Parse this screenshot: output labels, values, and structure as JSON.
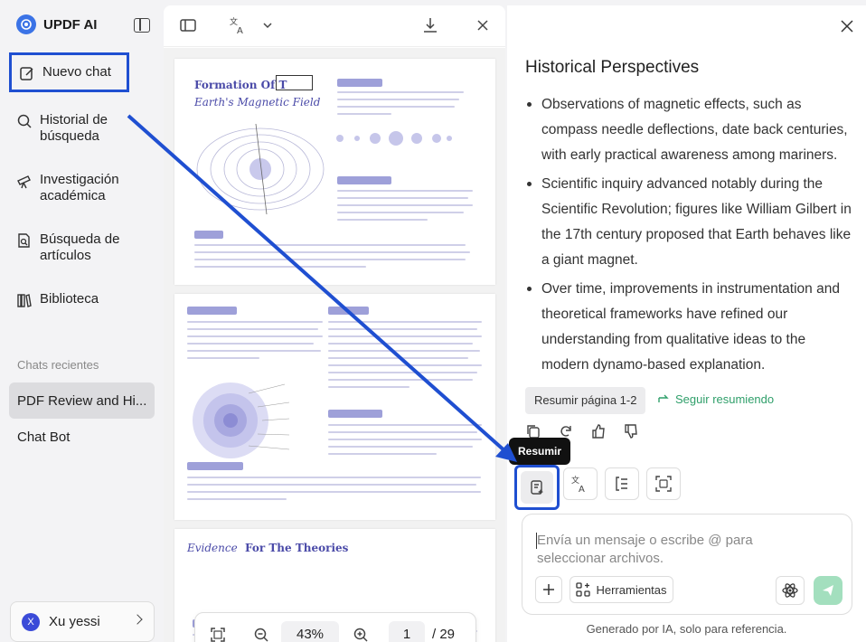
{
  "app": {
    "name": "UPDF AI",
    "accent": "#1f4fd1"
  },
  "sidebar": {
    "new_chat": "Nuevo chat",
    "items": [
      {
        "label": "Historial de búsqueda",
        "icon": "search-icon"
      },
      {
        "label": "Investigación académica",
        "icon": "telescope-icon"
      },
      {
        "label": "Búsqueda de artículos",
        "icon": "document-search-icon"
      },
      {
        "label": "Biblioteca",
        "icon": "library-icon"
      }
    ],
    "recent_label": "Chats recientes",
    "recent": [
      "PDF Review and Hi...",
      "Chat Bot"
    ],
    "user": {
      "initial": "X",
      "name": "Xu yessi"
    }
  },
  "document": {
    "page1_title_a": "Formation Of T",
    "page1_title_b": "Earth's Magnetic Field",
    "page3_title_a": "Evidence",
    "page3_title_b": "For The Theories",
    "zoom": "43%",
    "page": "1",
    "total": "/ 29"
  },
  "chat": {
    "heading": "Historical Perspectives",
    "bullets": [
      "Observations of magnetic effects, such as compass needle deflections, date back centuries, with early practical awareness among mariners.",
      "Scientific inquiry advanced notably during the Scientific Revolution; figures like William Gilbert in the 17th century proposed that Earth behaves like a giant magnet.",
      "Over time, improvements in instrumentation and theoretical frameworks have refined our understanding from qualitative ideas to the modern dynamo-based explanation."
    ],
    "summary_chip": "Resumir página 1-2",
    "continue_link": "Seguir resumiendo",
    "tooltip": "Resumir",
    "placeholder": "Envía un mensaje o escribe @ para seleccionar archivos.",
    "tools_label": "Herramientas",
    "footer": "Generado por IA, solo para referencia."
  }
}
